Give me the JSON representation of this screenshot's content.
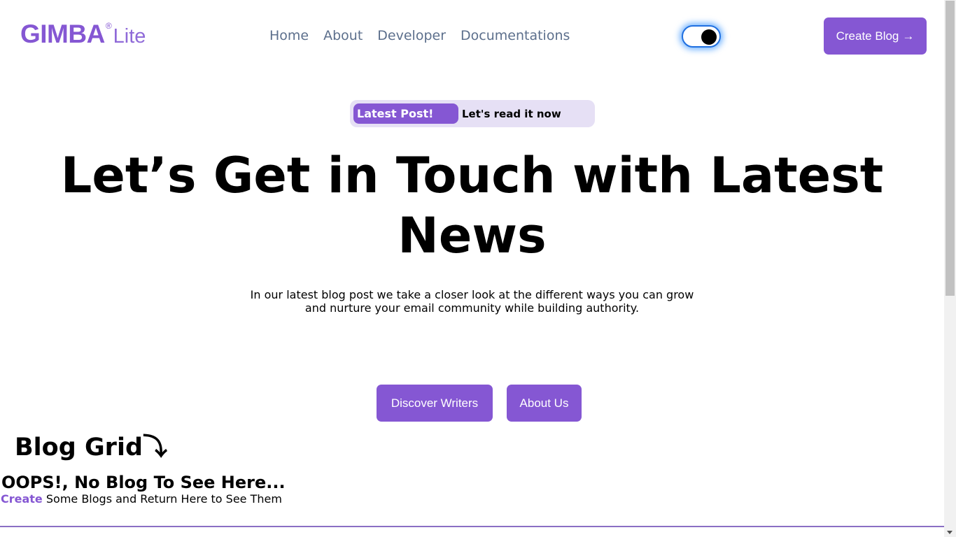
{
  "header": {
    "logo": {
      "main": "GIMBA",
      "registered": "®",
      "sub": "Lite"
    },
    "nav": [
      {
        "label": "Home"
      },
      {
        "label": "About"
      },
      {
        "label": "Developer"
      },
      {
        "label": "Documentations"
      }
    ],
    "theme_toggle": {
      "state": "on"
    },
    "create_blog": {
      "label": "Create Blog",
      "arrow": "→"
    }
  },
  "hero": {
    "latest_tag": "Latest Post!",
    "latest_text": "Let's read it now",
    "title": "Let’s Get in Touch with Latest News",
    "subtitle": "In our latest blog post we take a closer look at the different ways you can grow and nurture your email community while building authority.",
    "buttons": {
      "discover": "Discover Writers",
      "about": "About Us"
    }
  },
  "blog_grid": {
    "title": "Blog Grid",
    "title_icon": "⤵",
    "empty_title": "OOPS!, No Blog To See Here...",
    "empty_link": "Create",
    "empty_text": " Some Blogs and Return Here to See Them"
  },
  "colors": {
    "accent": "#8557d3",
    "nav_text": "#5c6f8c",
    "pill_bg": "#e6e0f5",
    "toggle_glow": "#288cff"
  }
}
